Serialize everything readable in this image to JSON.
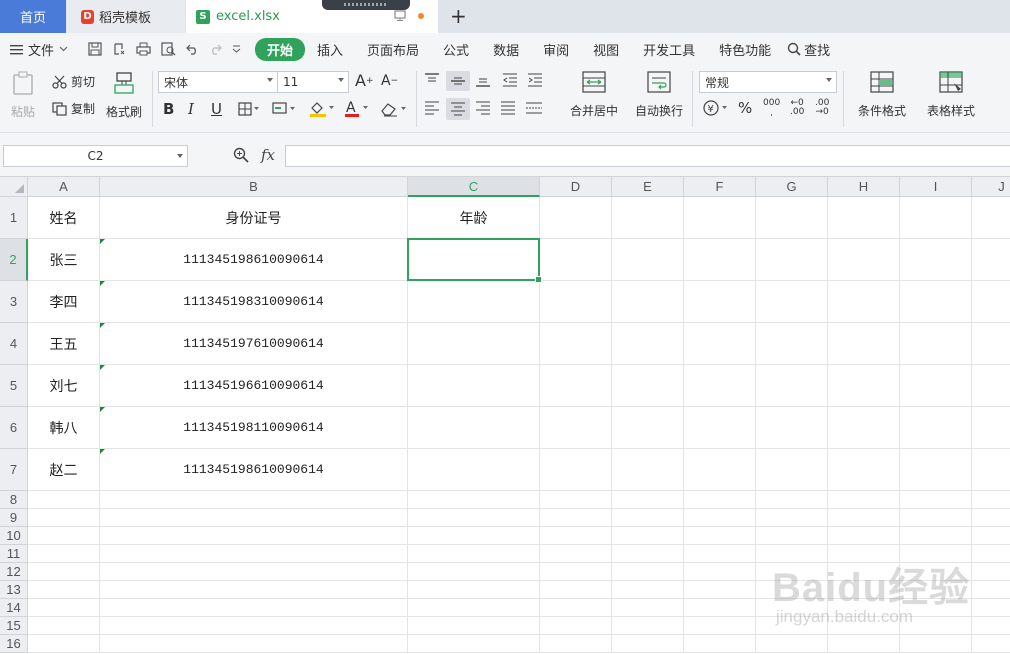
{
  "tabs": {
    "home": "首页",
    "template": "稻壳模板",
    "file": "excel.xlsx"
  },
  "menu": {
    "file": "文件",
    "items": [
      "开始",
      "插入",
      "页面布局",
      "公式",
      "数据",
      "审阅",
      "视图",
      "开发工具",
      "特色功能"
    ],
    "search": "查找"
  },
  "ribbon": {
    "paste": "粘贴",
    "cut": "剪切",
    "copy": "复制",
    "format_painter": "格式刷",
    "font_name": "宋体",
    "font_size": "11",
    "merge_center": "合并居中",
    "wrap_text": "自动换行",
    "number_format": "常规",
    "conditional_format": "条件格式",
    "table_style": "表格样式"
  },
  "formula": {
    "name_box": "C2",
    "fx": "fx",
    "value": ""
  },
  "sheet": {
    "columns": [
      "A",
      "B",
      "C",
      "D",
      "E",
      "F",
      "G",
      "H",
      "I",
      "J"
    ],
    "rows": [
      "1",
      "2",
      "3",
      "4",
      "5",
      "6",
      "7",
      "8",
      "9",
      "10",
      "11",
      "12",
      "13",
      "14",
      "15",
      "16"
    ],
    "header": [
      "姓名",
      "身份证号",
      "年龄"
    ],
    "data": [
      [
        "张三",
        "111345198610090614"
      ],
      [
        "李四",
        "111345198310090614"
      ],
      [
        "王五",
        "111345197610090614"
      ],
      [
        "刘七",
        "111345196610090614"
      ],
      [
        "韩八",
        "111345198110090614"
      ],
      [
        "赵二",
        "111345198610090614"
      ]
    ],
    "active_cell": "C2"
  },
  "watermark": {
    "logo": "Baidu经验",
    "url": "jingyan.baidu.com"
  },
  "colors": {
    "accent": "#2fa35c",
    "home_tab": "#4a7bd8"
  }
}
